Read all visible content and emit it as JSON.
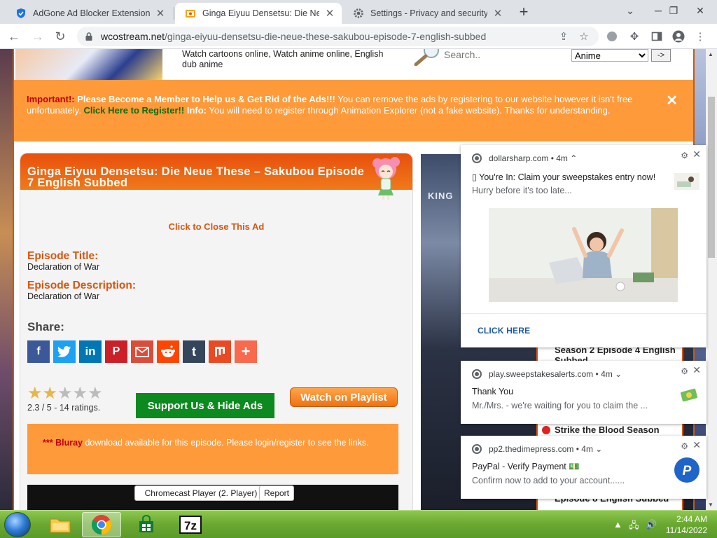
{
  "browser": {
    "tabs": [
      {
        "title": "AdGone Ad Blocker Extension",
        "active": false
      },
      {
        "title": "Ginga Eiyuu Densetsu: Die Neue",
        "active": true
      },
      {
        "title": "Settings - Privacy and security",
        "active": false
      }
    ],
    "url_host": "wcostream.net",
    "url_path": "/ginga-eiyuu-densetsu-die-neue-these-sakubou-episode-7-english-subbed"
  },
  "site": {
    "tagline": "Watch cartoons online, Watch anime online, English dub anime",
    "search_placeholder": "Search..",
    "category_selected": "Anime",
    "go_label": "->",
    "notice": {
      "important": "Important!:",
      "bold_text": "Please Become a Member to Help us & Get Rid of the Ads!!!",
      "text1": "You can remove the ads by registering to our website however it isn't free unfortunately.",
      "register_link": "Click Here to Register!!",
      "info_label": "Info:",
      "text2": "You will need to register through Animation Explorer (not a fake website). Thanks for understanding.",
      "close": "✕"
    },
    "title": "Ginga Eiyuu Densetsu: Die Neue These – Sakubou Episode 7 English Subbed",
    "close_ad": "Click to Close This Ad",
    "episode_title_label": "Episode Title:",
    "episode_title": "Declaration of War",
    "episode_desc_label": "Episode Description:",
    "episode_desc": "Declaration of War",
    "share_label": "Share:",
    "rating_text": "2.3 / 5 - 14 ratings.",
    "rating_value": 2.3,
    "rating_max": 5,
    "support_button": "Support Us & Hide Ads",
    "playlist_button": "Watch on Playlist",
    "bluray_stars": "***",
    "bluray_word": "Bluray",
    "bluray_text": "download available for this episode. Please login/register to see the links.",
    "chromecast_button": "Chromecast Player (2. Player)",
    "report_button": "Report",
    "banner_text": "KING",
    "episodes": [
      {
        "text": "Season 2 Episode 4 English Subbed"
      },
      {
        "text": "Strike the Blood Season"
      },
      {
        "text": "Episode 8 English Subbed"
      }
    ]
  },
  "notifications": [
    {
      "source": "dollarsharp.com",
      "age": "4m",
      "title": "You're In: Claim your sweepstakes entry now!",
      "body": "Hurry before it's too late...",
      "action": "CLICK HERE"
    },
    {
      "source": "play.sweepstakesalerts.com",
      "age": "4m",
      "title": "Thank You",
      "body": "Mr./Mrs.  - we're waiting for you to claim the ..."
    },
    {
      "source": "pp2.thedimepress.com",
      "age": "4m",
      "title": "PayPal - Verify Payment 💵",
      "body": "Confirm now to add to your account......"
    }
  ],
  "taskbar": {
    "time": "2:44 AM",
    "date": "11/14/2022"
  },
  "colors": {
    "accent_orange": "#ff9a3b",
    "title_orange": "#e84f0d",
    "support_green": "#0d8a1f",
    "taskbar_green": "#6aa832"
  }
}
